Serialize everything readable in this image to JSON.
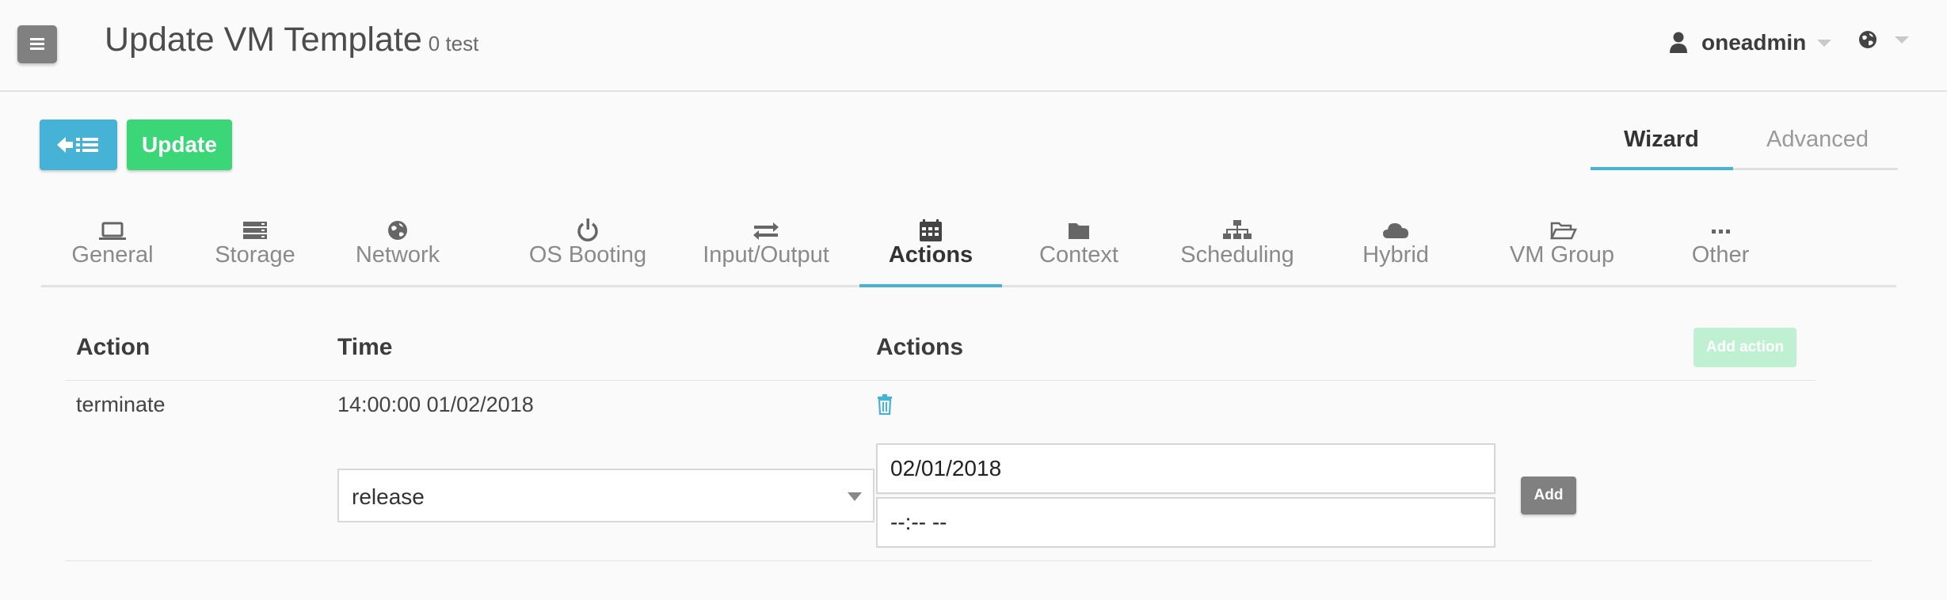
{
  "header": {
    "title": "Update VM Template",
    "subtitle": "0 test",
    "user": "oneadmin"
  },
  "toolbar": {
    "update_label": "Update"
  },
  "mode_tabs": [
    {
      "label": "Wizard",
      "active": true
    },
    {
      "label": "Advanced",
      "active": false
    }
  ],
  "section_tabs": [
    {
      "label": "General",
      "icon": "laptop-icon"
    },
    {
      "label": "Storage",
      "icon": "server-icon"
    },
    {
      "label": "Network",
      "icon": "globe-icon"
    },
    {
      "label": "OS Booting",
      "icon": "power-icon"
    },
    {
      "label": "Input/Output",
      "icon": "exchange-icon"
    },
    {
      "label": "Actions",
      "icon": "calendar-icon",
      "active": true
    },
    {
      "label": "Context",
      "icon": "folder-icon"
    },
    {
      "label": "Scheduling",
      "icon": "sitemap-icon"
    },
    {
      "label": "Hybrid",
      "icon": "cloud-icon"
    },
    {
      "label": "VM Group",
      "icon": "folder-open-icon"
    },
    {
      "label": "Other",
      "icon": "ellipsis-icon"
    }
  ],
  "actions_table": {
    "headers": [
      "Action",
      "Time",
      "Actions"
    ],
    "add_action_label": "Add action",
    "rows": [
      {
        "action": "terminate",
        "time": "14:00:00 01/02/2018"
      }
    ]
  },
  "new_action_form": {
    "action_value": "release",
    "date_value": "02/01/2018",
    "time_value": "--:-- --",
    "add_label": "Add"
  },
  "colors": {
    "accent": "#45b2d6",
    "success": "#3bd677",
    "neutral_button": "#808080"
  }
}
